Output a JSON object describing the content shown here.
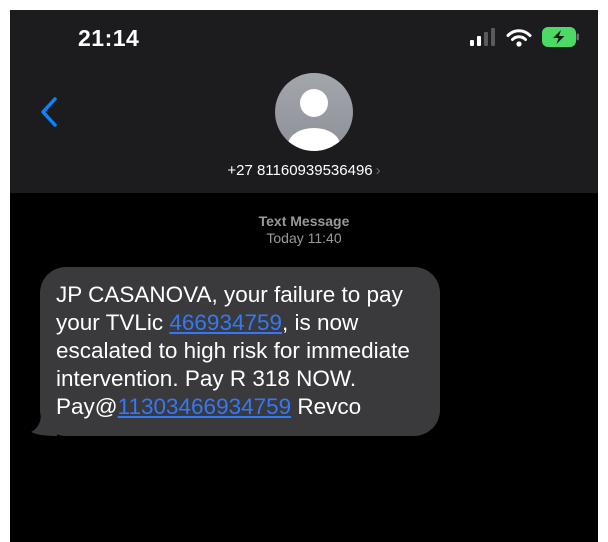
{
  "status_bar": {
    "time": "21:14",
    "icons": [
      "signal-icon",
      "wifi-icon",
      "battery-charging-icon"
    ]
  },
  "header": {
    "back_icon": "chevron-left-icon",
    "avatar_icon": "person-silhouette-icon",
    "contact_number": "+27 81160939536496",
    "contact_chevron": "›"
  },
  "thread": {
    "meta_kind": "Text Message",
    "meta_time": "Today 11:40"
  },
  "message": {
    "part1": "JP CASANOVA, your failure to pay your TVLic ",
    "link1": "466934759",
    "part2": ", is now escalated to high risk for immediate intervention. Pay R 318 NOW.",
    "part3": "Pay@",
    "link2": "11303466934759",
    "part4": " Revco"
  },
  "colors": {
    "background": "#000000",
    "header": "#1c1c1e",
    "bubble": "#3a3a3c",
    "link": "#3478f6",
    "accent": "#0a84ff",
    "battery_charge": "#4cd964"
  }
}
